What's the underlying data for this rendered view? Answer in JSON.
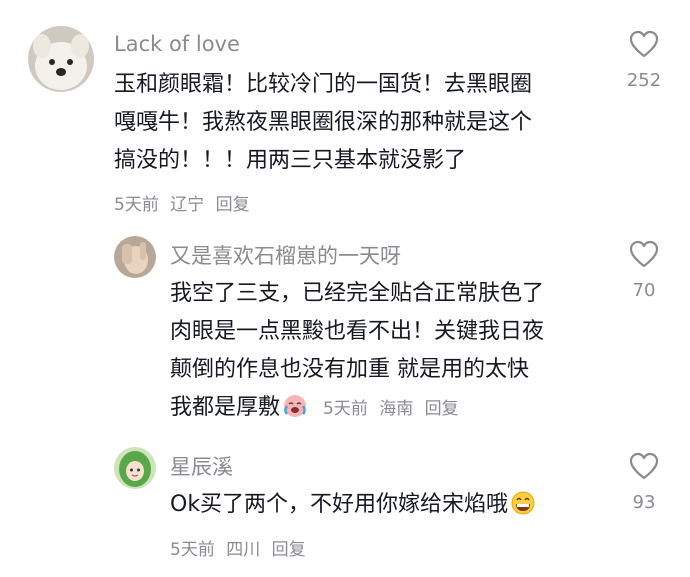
{
  "comments": [
    {
      "username": "Lack of love",
      "lines": [
        "玉和颜眼霜！比较冷门的一国货！去黑眼圈",
        "嘎嘎牛！我熬夜黑眼圈很深的那种就是这个",
        "搞没的！！！用两三只基本就没影了"
      ],
      "time": "5天前",
      "location": "辽宁",
      "reply_label": "回复",
      "likes": "252",
      "avatar_icon": "white-puppy-avatar"
    },
    {
      "username": "又是喜欢石榴崽的一天呀",
      "lines": [
        "我空了三支，已经完全贴合正常肤色了",
        "肉眼是一点黑黢也看不出！关键我日夜",
        "颠倒的作息也没有加重 就是用的太快",
        "我都是厚敷"
      ],
      "trailing_emoji": "crying-laughing-emoji",
      "time": "5天前",
      "location": "海南",
      "reply_label": "回复",
      "likes": "70",
      "avatar_icon": "hand-photo-avatar"
    },
    {
      "username": "星辰溪",
      "lines": [
        "Ok买了两个，不好用你嫁给宋焰哦"
      ],
      "trailing_emoji": "grinning-emoji",
      "time": "5天前",
      "location": "四川",
      "reply_label": "回复",
      "likes": "93",
      "avatar_icon": "green-hair-girl-avatar"
    }
  ],
  "icons": {
    "like": "heart-outline-icon"
  },
  "colors": {
    "text": "#161823",
    "muted": "#8a8b91"
  }
}
